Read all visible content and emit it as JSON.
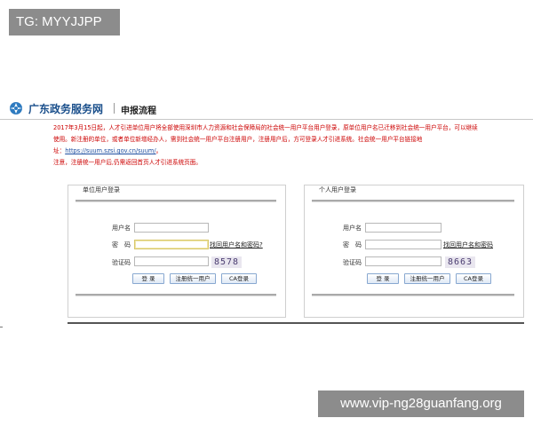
{
  "watermark_top": "TG: MYYJJPP",
  "watermark_bottom": "www.vip-ng28guanfang.org",
  "header": {
    "site_title": "广东政务服务网",
    "tab": "申报流程"
  },
  "notice": {
    "line1": "2017年3月15日起，人才引进单位用户将全部使用深圳市人力资源和社会保障局的社会统一用户平台用户登录，原单位用户名已迁移到社会统一用户平台，可以继续",
    "line2": "使用。新注册的单位，或者单位新增经办人，需到社会统一用户平台注册用户，注册用户后，方可登录人才引进系统。社会统一用户平台链接地",
    "line3_prefix": "址：",
    "line3_link": "https://suum.szsi.gov.cn/suum/",
    "line3_suffix": "。",
    "line4": "注意，注册统一用户后,仍需返回首页人才引进系统页面。"
  },
  "unit_login": {
    "title": "单位用户登录",
    "username_label": "用户名",
    "password_label": "密　码",
    "captcha_label": "验证码",
    "username_value": "",
    "password_value": "",
    "captcha_value": "",
    "forgot_link": "找回用户名和密码?",
    "captcha_code": "8578",
    "login_button": "登 录",
    "register_button": "注册统一用户",
    "ca_button": "CA登录"
  },
  "personal_login": {
    "title": "个人用户登录",
    "username_label": "用户名",
    "password_label": "密　码",
    "captcha_label": "验证码",
    "username_value": "",
    "password_value": "",
    "captcha_value": "",
    "forgot_link": "找回用户名和密码",
    "captcha_code": "8663",
    "login_button": "登 录",
    "register_button": "注册统一用户",
    "ca_button": "CA登录"
  },
  "colors": {
    "notice_red": "#cc0000",
    "brand_blue": "#1a4f8b",
    "watermark_gray": "#8c8c8c"
  }
}
